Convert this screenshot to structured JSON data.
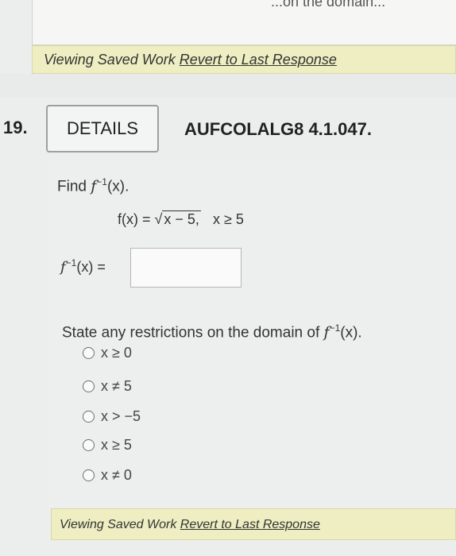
{
  "top": {
    "cut_text": "...on the domain..."
  },
  "banner": {
    "viewing": "Viewing Saved Work ",
    "revert": "Revert to Last Response"
  },
  "question": {
    "number": "19.",
    "details_label": "DETAILS",
    "id": "AUFCOLALG8 4.1.047.",
    "find_prefix": "Find ",
    "find_fn": "f",
    "find_exp": "−1",
    "find_suffix": "(x).",
    "eq_left": "f(x) = ",
    "eq_sqrt": "√",
    "eq_rad": "x − 5,",
    "eq_cond": "x ≥ 5",
    "answer_label_fn": "f",
    "answer_label_exp": "−1",
    "answer_label_suffix": "(x) =",
    "answer_value": ""
  },
  "restriction": {
    "prompt_prefix": "State any restrictions on the domain of ",
    "prompt_fn": "f",
    "prompt_exp": "−1",
    "prompt_suffix": "(x).",
    "options": [
      "x ≥ 0",
      "x ≠ 5",
      "x > −5",
      "x ≥ 5",
      "x ≠ 0"
    ]
  },
  "footer": {
    "viewing": "Viewing Saved Work ",
    "revert": "Revert to Last Response"
  }
}
